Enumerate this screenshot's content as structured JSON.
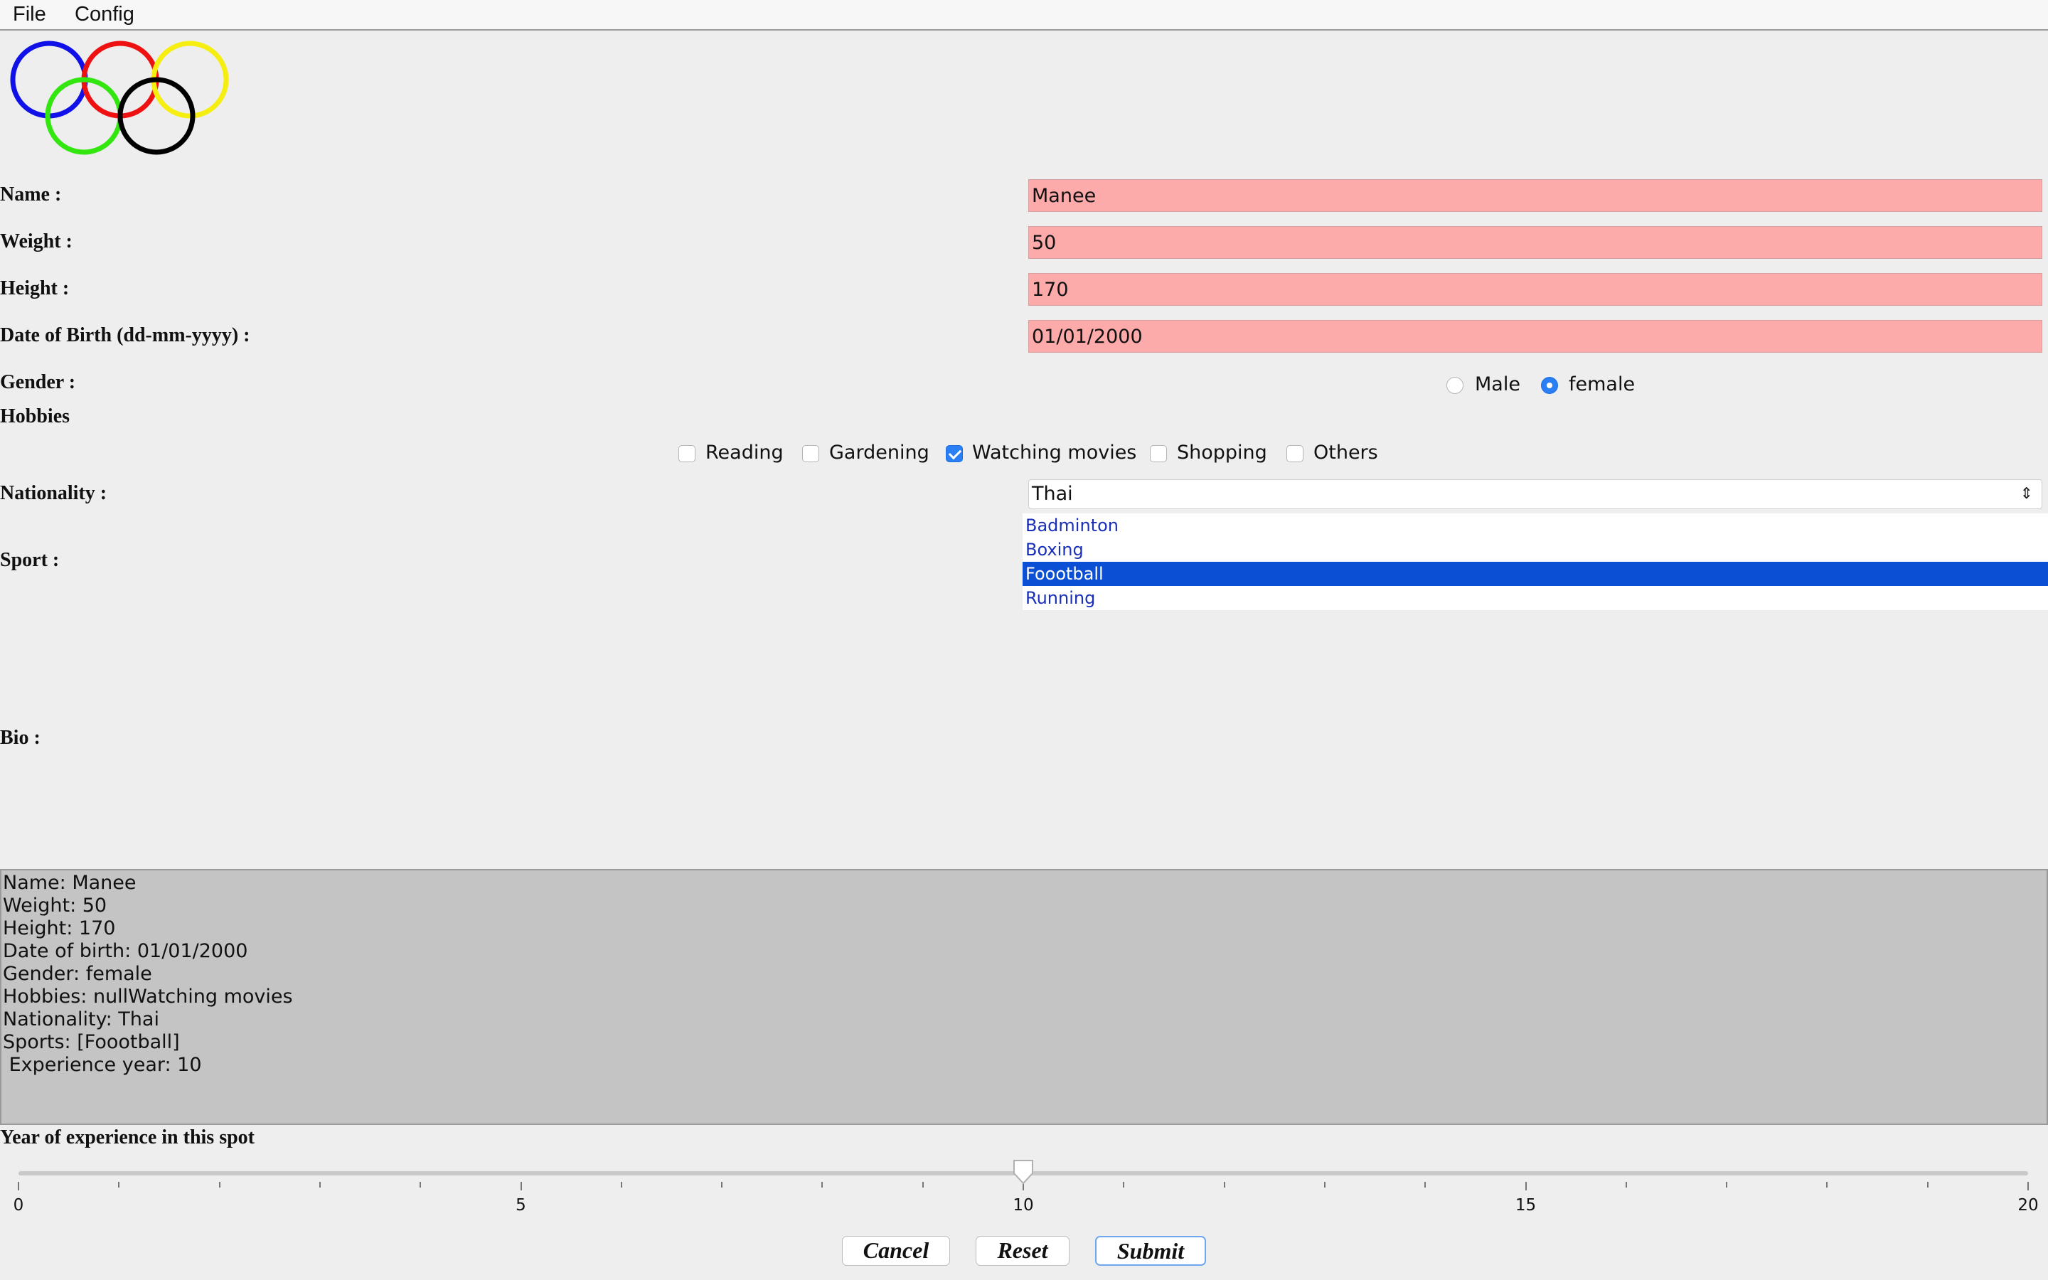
{
  "menubar": {
    "file": "File",
    "config": "Config"
  },
  "logo": {
    "ring_colors": [
      "#1010e8",
      "#ee1111",
      "#f5ee10",
      "#33e610",
      "#000000"
    ]
  },
  "form": {
    "name": {
      "label": "Name :",
      "value": "Manee"
    },
    "weight": {
      "label": "Weight :",
      "value": "50"
    },
    "height": {
      "label": "Height :",
      "value": "170"
    },
    "dob": {
      "label": "Date of Birth (dd-mm-yyyy) :",
      "value": "01/01/2000"
    },
    "gender": {
      "label": "Gender :",
      "options": [
        "Male",
        "female"
      ],
      "selected": "female"
    },
    "hobbies": {
      "label": "Hobbies",
      "options": [
        {
          "label": "Reading",
          "checked": false
        },
        {
          "label": "Gardening",
          "checked": false
        },
        {
          "label": "Watching movies",
          "checked": true
        },
        {
          "label": "Shopping",
          "checked": false
        },
        {
          "label": "Others",
          "checked": false
        }
      ]
    },
    "nationality": {
      "label": "Nationality :",
      "value": "Thai"
    },
    "sport": {
      "label": "Sport :",
      "items": [
        "Badminton",
        "Boxing",
        "Foootball",
        "Running"
      ],
      "selected": "Foootball"
    },
    "bio": {
      "label": "Bio :"
    }
  },
  "summary": {
    "lines": [
      "Name: Manee",
      "Weight: 50",
      "Height: 170",
      "Date of birth: 01/01/2000",
      "Gender: female",
      "Hobbies: nullWatching movies",
      "Nationality: Thai",
      "Sports: [Foootball]",
      " Experience year: 10"
    ]
  },
  "experience": {
    "label": "Year of experience in this spot",
    "min": 0,
    "max": 20,
    "value": 10,
    "major_labels": [
      "0",
      "5",
      "10",
      "15",
      "20"
    ]
  },
  "buttons": {
    "cancel": "Cancel",
    "reset": "Reset",
    "submit": "Submit"
  }
}
